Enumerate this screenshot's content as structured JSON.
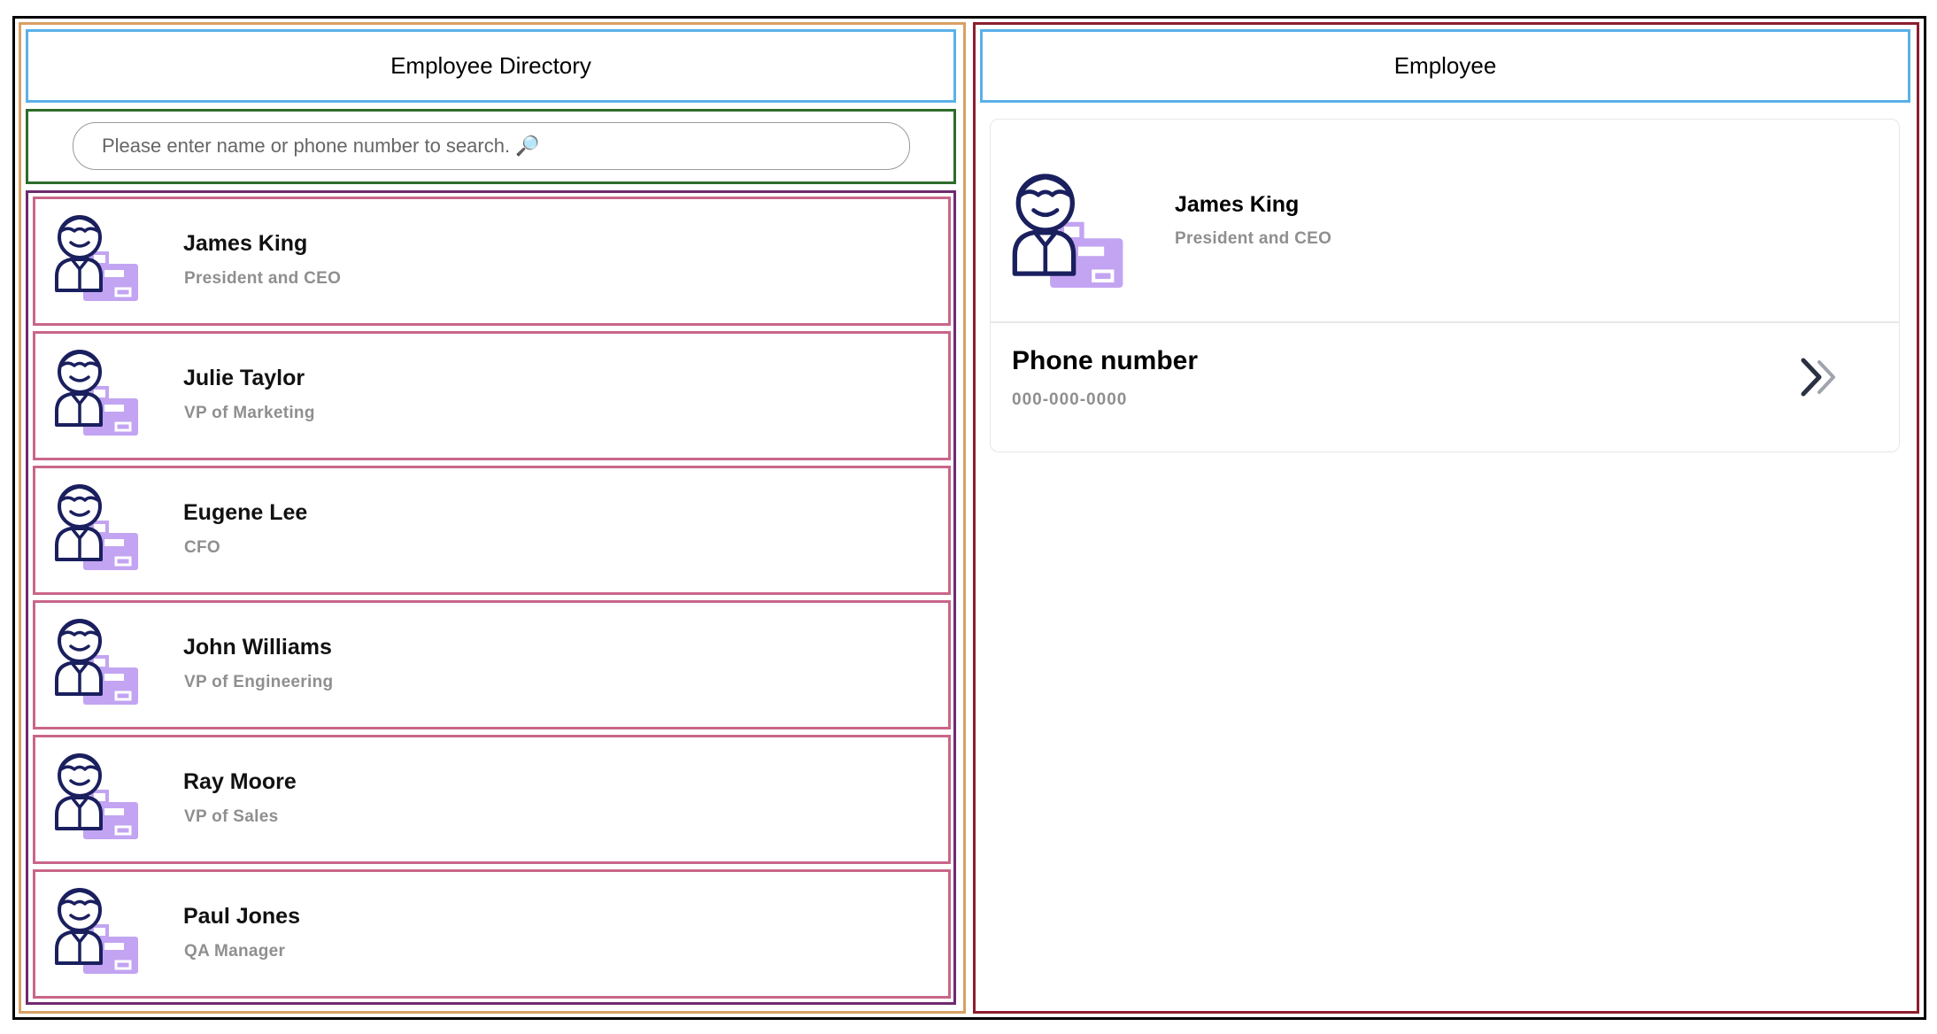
{
  "left_header": {
    "title": "Employee Directory"
  },
  "search": {
    "placeholder": "Please enter name or phone number to search. 🔎",
    "value": ""
  },
  "employees": [
    {
      "name": "James King",
      "title": "President and CEO"
    },
    {
      "name": "Julie Taylor",
      "title": "VP of Marketing"
    },
    {
      "name": "Eugene Lee",
      "title": "CFO"
    },
    {
      "name": "John Williams",
      "title": "VP of Engineering"
    },
    {
      "name": "Ray Moore",
      "title": "VP of Sales"
    },
    {
      "name": "Paul Jones",
      "title": "QA Manager"
    }
  ],
  "right_header": {
    "title": "Employee"
  },
  "detail": {
    "name": "James King",
    "title": "President and CEO",
    "phone_label": "Phone number",
    "phone_value": "000-000-0000"
  },
  "icons": {
    "avatar": "employee-avatar-icon",
    "action": "double-chevron-right-icon"
  },
  "colors": {
    "avatar_outline": "#1a1f5e",
    "briefcase": "#c2a4f2",
    "title_text": "#8f8f8f",
    "chevron_dark": "#2b3042",
    "chevron_light": "#a0a4ad"
  }
}
